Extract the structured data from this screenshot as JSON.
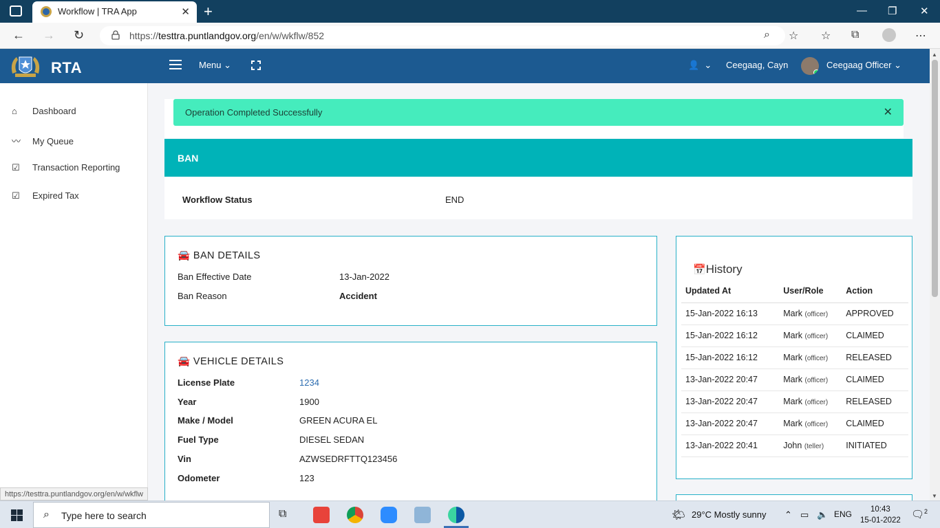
{
  "browser": {
    "tab_title": "Workflow | TRA App",
    "url_prefix": "https://",
    "url_host": "testtra.puntlandgov.org",
    "url_path": "/en/w/wkflw/852",
    "status_url": "https://testtra.puntlandgov.org/en/w/wkflw"
  },
  "header": {
    "brand": "RTA",
    "menu_label": "Menu",
    "user_name": "Ceegaag, Cayn",
    "role_label": "Ceegaag Officer"
  },
  "sidebar": {
    "items": [
      {
        "label": "Dashboard",
        "icon": "home-icon"
      },
      {
        "label": "My Queue",
        "icon": "trend-line-icon"
      },
      {
        "label": "Transaction Reporting",
        "icon": "checkbox-icon"
      },
      {
        "label": "Expired Tax",
        "icon": "checkbox-icon"
      }
    ]
  },
  "alert": {
    "message": "Operation Completed Successfully"
  },
  "ban": {
    "header": "BAN",
    "workflow_status_label": "Workflow Status",
    "workflow_status_value": "END"
  },
  "ban_details": {
    "title": "BAN DETAILS",
    "effective_date_label": "Ban Effective Date",
    "effective_date_value": "13-Jan-2022",
    "reason_label": "Ban Reason",
    "reason_value": "Accident"
  },
  "vehicle_details": {
    "title": "VEHICLE DETAILS",
    "rows": [
      {
        "label": "License Plate",
        "value": "1234"
      },
      {
        "label": "Year",
        "value": "1900"
      },
      {
        "label": "Make / Model",
        "value": "GREEN ACURA EL"
      },
      {
        "label": "Fuel Type",
        "value": "DIESEL SEDAN"
      },
      {
        "label": "Vin",
        "value": "AZWSEDRFTTQ123456"
      },
      {
        "label": "Odometer",
        "value": "123"
      }
    ]
  },
  "history": {
    "title": "History",
    "columns": [
      "Updated At",
      "User/Role",
      "Action"
    ],
    "rows": [
      {
        "updated": "15-Jan-2022 16:13",
        "user": "Mark",
        "role": "(officer)",
        "action": "APPROVED"
      },
      {
        "updated": "15-Jan-2022 16:12",
        "user": "Mark",
        "role": "(officer)",
        "action": "CLAIMED"
      },
      {
        "updated": "15-Jan-2022 16:12",
        "user": "Mark",
        "role": "(officer)",
        "action": "RELEASED"
      },
      {
        "updated": "13-Jan-2022 20:47",
        "user": "Mark",
        "role": "(officer)",
        "action": "CLAIMED"
      },
      {
        "updated": "13-Jan-2022 20:47",
        "user": "Mark",
        "role": "(officer)",
        "action": "RELEASED"
      },
      {
        "updated": "13-Jan-2022 20:47",
        "user": "Mark",
        "role": "(officer)",
        "action": "CLAIMED"
      },
      {
        "updated": "13-Jan-2022 20:41",
        "user": "John",
        "role": "(teller)",
        "action": "INITIATED"
      }
    ]
  },
  "taskbar": {
    "search_placeholder": "Type here to search",
    "weather": "29°C  Mostly sunny",
    "language": "ENG",
    "time": "10:43",
    "date": "15-01-2022",
    "notifications": "2"
  },
  "colors": {
    "header_bg": "#1c5a91",
    "alert_bg": "#45ecbd",
    "ban_header_bg": "#00b3b8",
    "panel_border": "#26b0c7"
  }
}
